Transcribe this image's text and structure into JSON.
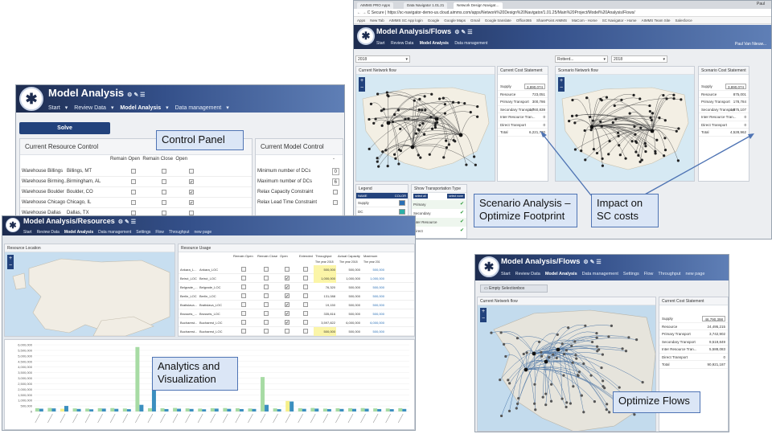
{
  "callouts": {
    "control_panel": "Control Panel",
    "scenario_analysis": "Scenario Analysis – Optimize Footprint",
    "impact": "Impact on SC costs",
    "analytics": "Analytics and Visualization",
    "optimize_flows": "Optimize Flows"
  },
  "win1": {
    "title": "Model Analysis",
    "nav": [
      "Start",
      "Review Data",
      "Model Analysis",
      "Data management"
    ],
    "solve_label": "Solve",
    "resource_control": {
      "title": "Current Resource Control",
      "columns": [
        "Remain Open",
        "Remain Close",
        "Open"
      ],
      "rows": [
        {
          "name": "Warehouse Billings",
          "loc": "Billings, MT",
          "remain_open": "",
          "remain_close": "",
          "open": ""
        },
        {
          "name": "Warehouse Birming...",
          "loc": "Birmingham, AL",
          "remain_open": "",
          "remain_close": "",
          "open": "✔"
        },
        {
          "name": "Warehouse Boulder",
          "loc": "Boulder, CO",
          "remain_open": "",
          "remain_close": "",
          "open": "✔"
        },
        {
          "name": "Warehouse Chicago",
          "loc": "Chicago, IL",
          "remain_open": "",
          "remain_close": "",
          "open": "✔"
        },
        {
          "name": "Warehouse Dallas",
          "loc": "Dallas, TX",
          "remain_open": "",
          "remain_close": "",
          "open": ""
        }
      ]
    },
    "model_control": {
      "title": "Current Model Control",
      "dash": "-",
      "rows": [
        {
          "label": "Minimum number of DCs",
          "value": "0"
        },
        {
          "label": "Maximum number of DCs",
          "value": "6"
        },
        {
          "label": "Relax Capacity Constraint",
          "value": ""
        },
        {
          "label": "Relax Lead Time Constraint",
          "value": ""
        }
      ]
    }
  },
  "win2": {
    "tabs": [
      "AIMMS PRO Apps",
      "Data Navigator 1.01.21",
      "Network Design Navigat…"
    ],
    "user": "Paul",
    "url": "Secure | https://sc-navigator-demo-us.cloud.aimms.com/apps/Network%20Design%20Navigator/1.01.25/Main%20Project/Model%20Analysis/Flows/",
    "bookmarks": [
      "Apps",
      "New Tab",
      "AIMMS SC App login",
      "Google",
      "Google Maps",
      "Gmail",
      "Google translate",
      "Office365",
      "SharePoint AIMMS",
      "MaCom - Home",
      "SC Navigator - Home",
      "AIMMS Team Site",
      "Salesforce"
    ],
    "title": "Model Analysis/Flows",
    "nav": [
      "Start",
      "Review Data",
      "Model Analysis",
      "Data management"
    ],
    "app_user": "Paul Van Nieuw...",
    "select_year_left": "2018",
    "select_scenario": "Rotterd...",
    "select_year_right": "2018",
    "panel_network_left": "Current Network flow",
    "panel_cost_left": "Current Cost Statement",
    "panel_network_right": "Scenario Network flow",
    "panel_cost_right": "Scenario Cost Statement",
    "cost_left": [
      {
        "label": "Supply",
        "value": "3,890,074"
      },
      {
        "label": "Resource",
        "value": "723,051"
      },
      {
        "label": "Primary Transport",
        "value": "300,786"
      },
      {
        "label": "Secondary Transport",
        "value": "1,760,839"
      },
      {
        "label": "Inter Resource Tran...",
        "value": "0"
      },
      {
        "label": "Direct Transport",
        "value": "0"
      },
      {
        "label": "Total",
        "value": "6,221,730"
      }
    ],
    "cost_right": [
      {
        "label": "Supply",
        "value": "3,890,074"
      },
      {
        "label": "Resource",
        "value": "875,001"
      },
      {
        "label": "Primary Transport",
        "value": "178,784"
      },
      {
        "label": "Secondary Transport",
        "value": "1,875,107"
      },
      {
        "label": "Inter Resource Tran...",
        "value": "0"
      },
      {
        "label": "Direct Transport",
        "value": "0"
      },
      {
        "label": "Total",
        "value": "4,528,962"
      }
    ],
    "legend_title": "Legend",
    "legend_header": [
      "NAME",
      "COLOR"
    ],
    "legend_rows": [
      {
        "name": "Supply",
        "color": "#2a6fb5"
      },
      {
        "name": "DC",
        "color": "#2bb0a8"
      },
      {
        "name": "Demand",
        "color": "#e6e6e6"
      }
    ],
    "transport_title": "Show Transportation Type",
    "transport_btn1": "select all",
    "transport_btn2": "select none",
    "transport_rows": [
      "Primary",
      "Secondary",
      "Inter Resource",
      "Direct"
    ]
  },
  "win3": {
    "title": "Model Analysis/Resources",
    "nav": [
      "Start",
      "Review Data",
      "Model Analysis",
      "Data management",
      "Settings",
      "Flow",
      "Throughput",
      "new page"
    ],
    "panel_location": "Resource Location",
    "panel_usage": "Resource Usage",
    "usage_columns": [
      "Remain Open",
      "Remain Close",
      "Open",
      "Extended",
      "Throughput",
      "Actual Capacity",
      "Maximum"
    ],
    "usage_subcols": [
      "The year 2018",
      "The year 2018",
      "The year 201"
    ],
    "usage_rows": [
      {
        "name": "Ankara_L...",
        "loc": "Ankara_LOC",
        "open": "",
        "throughput": "500,000",
        "actual": "500,000",
        "max": "500,000",
        "hl": true
      },
      {
        "name": "Beirut_LOC",
        "loc": "Beirut_LOC",
        "open": "✔",
        "throughput": "1,000,000",
        "actual": "1,000,000",
        "max": "1,000,000",
        "hl": true
      },
      {
        "name": "Belgrade_...",
        "loc": "Belgrade_LOC",
        "open": "✔",
        "throughput": "76,320",
        "actual": "500,000",
        "max": "500,000",
        "hl": false
      },
      {
        "name": "Berlin_LOC",
        "loc": "Berlin_LOC",
        "open": "✔",
        "throughput": "131,088",
        "actual": "500,000",
        "max": "500,000",
        "hl": false
      },
      {
        "name": "Bratislava...",
        "loc": "Bratislava_LOC",
        "open": "✔",
        "throughput": "19,150",
        "actual": "500,000",
        "max": "500,000",
        "hl": false
      },
      {
        "name": "Brussels_...",
        "loc": "Brussels_LOC",
        "open": "✔",
        "throughput": "335,816",
        "actual": "500,000",
        "max": "500,000",
        "hl": false
      },
      {
        "name": "Bucharest...",
        "loc": "Bucharest_LOC",
        "open": "✔",
        "throughput": "3,597,822",
        "actual": "6,000,000",
        "max": "6,000,000",
        "hl": false
      },
      {
        "name": "Bucharest...",
        "loc": "Bucharest_LOC",
        "open": "",
        "throughput": "500,000",
        "actual": "500,000",
        "max": "500,000",
        "hl": true
      }
    ]
  },
  "chart_data": {
    "type": "bar",
    "ylim": [
      0,
      6000000
    ],
    "yticks": [
      "6,000,000",
      "5,500,000",
      "5,000,000",
      "4,500,000",
      "4,000,000",
      "3,500,000",
      "3,000,000",
      "2,500,000",
      "2,000,000",
      "1,500,000",
      "1,000,000",
      "500,000",
      "0"
    ],
    "series": [
      {
        "values": [
          300000,
          320000,
          250000,
          280000,
          260000,
          300000,
          310000,
          270000,
          5800000,
          300000,
          290000,
          320000,
          280000,
          260000,
          300000,
          310000,
          290000,
          270000,
          3100000,
          280000,
          950000,
          300000,
          320000,
          260000,
          290000,
          300000,
          310000,
          280000,
          270000,
          300000
        ]
      },
      {
        "values": [
          250000,
          280000,
          500000,
          230000,
          200000,
          260000,
          240000,
          210000,
          600000,
          3500000,
          220000,
          250000,
          230000,
          200000,
          260000,
          240000,
          220000,
          230000,
          600000,
          210000,
          900000,
          240000,
          260000,
          220000,
          230000,
          240000,
          250000,
          220000,
          210000,
          230000
        ]
      }
    ],
    "series_colors": [
      "#a7dba4",
      "#3b8fbf",
      "#f6f08a"
    ]
  },
  "win4": {
    "title": "Model Analysis/Flows",
    "nav": [
      "Start",
      "Review Data",
      "Model Analysis",
      "Data management",
      "Settings",
      "Flow",
      "Throughput",
      "new page"
    ],
    "selection_btn": "Empty Selectionbox",
    "panel_network": "Current Network flow",
    "panel_cost": "Current Cost Statement",
    "cost": [
      {
        "label": "Supply",
        "value": "46,790,398"
      },
      {
        "label": "Resource",
        "value": "24,495,215"
      },
      {
        "label": "Primary Transport",
        "value": "3,742,902"
      },
      {
        "label": "Secondary Transport",
        "value": "9,519,849"
      },
      {
        "label": "Inter Resource Tran...",
        "value": "5,588,083"
      },
      {
        "label": "Direct Transport",
        "value": "0"
      },
      {
        "label": "Total",
        "value": "90,921,187"
      }
    ]
  }
}
